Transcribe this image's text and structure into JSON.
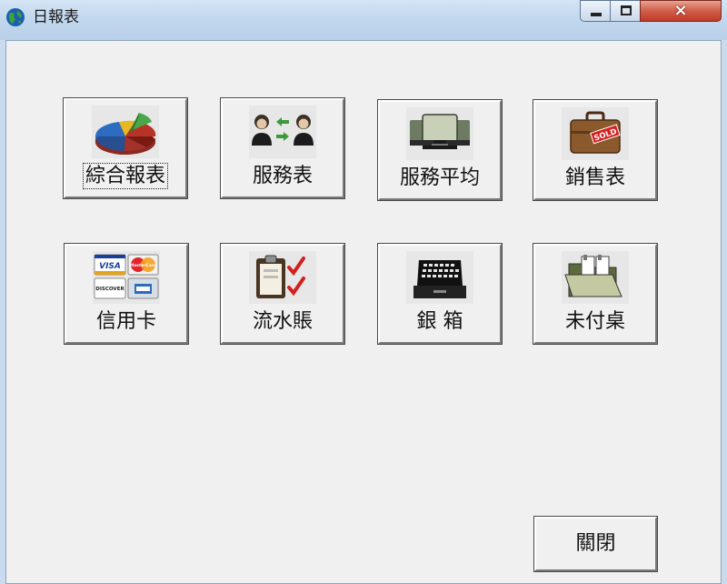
{
  "window": {
    "title": "日報表",
    "app_icon": "globe-icon",
    "controls": {
      "minimize": "minimize-icon",
      "maximize": "maximize-icon",
      "close": "×"
    }
  },
  "buttons": [
    {
      "label": "綜合報表",
      "icon": "pie-chart-icon"
    },
    {
      "label": "服務表",
      "icon": "people-exchange-icon"
    },
    {
      "label": "服務平均",
      "icon": "stacked-devices-icon"
    },
    {
      "label": "銷售表",
      "icon": "sold-briefcase-icon"
    },
    {
      "label": "信用卡",
      "icon": "credit-cards-icon",
      "card_text": [
        "VISA",
        "MasterCard",
        "DISCOVER"
      ]
    },
    {
      "label": "流水賬",
      "icon": "clipboard-checklist-icon"
    },
    {
      "label": "銀 箱",
      "icon": "cash-register-icon"
    },
    {
      "label": "未付桌",
      "icon": "open-folder-icon"
    }
  ],
  "sold_tag": "SOLD",
  "close_button": {
    "label": "關閉"
  },
  "colors": {
    "window_bg": "#f0f0f0",
    "frame": "#c9dcef",
    "close_red": "#c03a27"
  }
}
